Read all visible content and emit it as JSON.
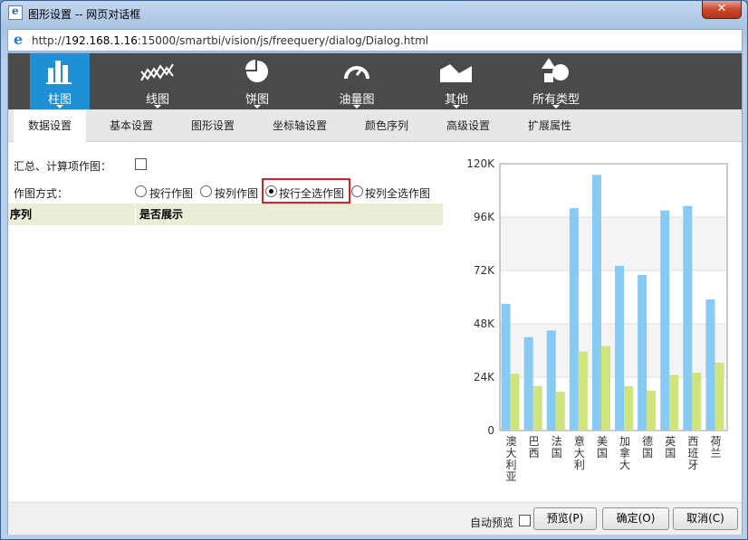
{
  "window": {
    "title": "图形设置 -- 网页对话框",
    "close_label": "✕",
    "url_prefix": "http://",
    "url_host": "192.168.1.16",
    "url_rest": ":15000/smartbi/vision/js/freequery/dialog/Dialog.html"
  },
  "chart_types": [
    {
      "label": "柱图",
      "icon": "bar-chart-icon"
    },
    {
      "label": "线图",
      "icon": "line-chart-icon"
    },
    {
      "label": "饼图",
      "icon": "pie-chart-icon"
    },
    {
      "label": "油量图",
      "icon": "gauge-icon"
    },
    {
      "label": "其他",
      "icon": "area-chart-icon"
    },
    {
      "label": "所有类型",
      "icon": "shapes-icon"
    }
  ],
  "tabs": [
    "数据设置",
    "基本设置",
    "图形设置",
    "坐标轴设置",
    "颜色序列",
    "高级设置",
    "扩展属性"
  ],
  "settings": {
    "summary_label": "汇总、计算项作图：",
    "mode_label": "作图方式：",
    "options": [
      "按行作图",
      "按列作图",
      "按行全选作图",
      "按列全选作图"
    ],
    "selected_option": 2
  },
  "grid": {
    "columns": [
      "序列",
      "是否展示"
    ]
  },
  "chart_data": {
    "type": "bar",
    "categories": [
      "澳大利亚",
      "巴西",
      "法国",
      "意大利",
      "美国",
      "加拿大",
      "德国",
      "英国",
      "西班牙",
      "荷兰"
    ],
    "series": [
      {
        "values": [
          57000,
          42000,
          45000,
          100000,
          115000,
          74000,
          70000,
          99000,
          101000,
          59000
        ],
        "color": "#87cbf5"
      },
      {
        "values": [
          25500,
          20000,
          17500,
          35500,
          38000,
          20000,
          18000,
          25000,
          26000,
          30500
        ],
        "color": "#cfe47a"
      }
    ],
    "y_ticks": [
      "0",
      "24K",
      "48K",
      "72K",
      "96K",
      "120K"
    ],
    "ylim": [
      0,
      120000
    ],
    "grid": true
  },
  "footer": {
    "auto_preview_label": "自动预览",
    "preview_button": "预览(P)",
    "ok_button": "确定(O)",
    "cancel_button": "取消(C)"
  }
}
